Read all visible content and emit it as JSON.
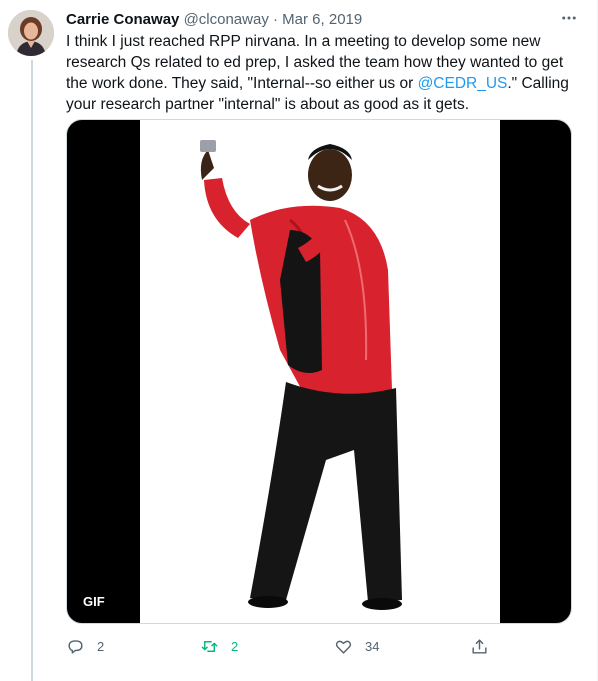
{
  "tweet": {
    "author_name": "Carrie Conaway",
    "handle": "@clconaway",
    "separator": "·",
    "date": "Mar 6, 2019",
    "more_icon": "more-horizontal-icon",
    "text_before_mention": "I think I just reached RPP nirvana. In a meeting to develop some new research Qs related to ed prep, I asked the team how they wanted to get the work done. They said, \"Internal--so either us or ",
    "mention": "@CEDR_US",
    "text_after_mention": ".\" Calling your research partner \"internal\" is about as good as it gets.",
    "media": {
      "badge": "GIF"
    },
    "actions": {
      "reply_count": "2",
      "retweet_count": "2",
      "like_count": "34",
      "reply_icon": "reply-icon",
      "retweet_icon": "retweet-icon",
      "like_icon": "heart-icon",
      "share_icon": "share-icon"
    },
    "colors": {
      "accent": "#1d9bf0",
      "retweeted": "#00ba7c",
      "secondary_text": "#536471"
    }
  }
}
